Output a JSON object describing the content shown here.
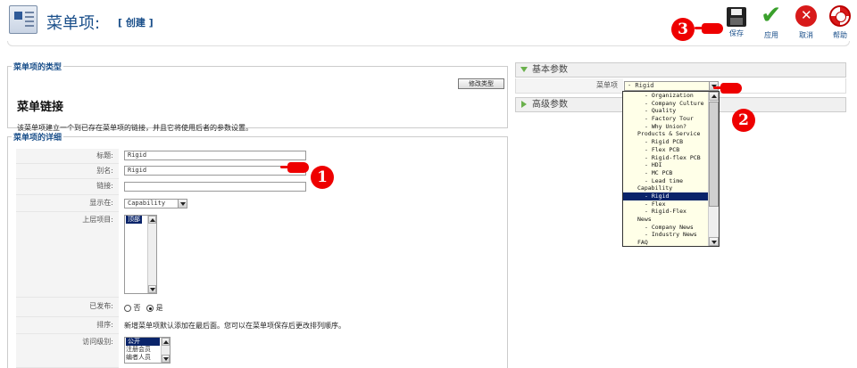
{
  "header": {
    "title": "菜单项:",
    "subtitle": "[ 创建 ]"
  },
  "toolbar": {
    "save_label": "保存",
    "apply_label": "应用",
    "cancel_label": "取消",
    "help_label": "帮助"
  },
  "markers": {
    "m1": "1",
    "m2": "2",
    "m3": "3"
  },
  "menu_type": {
    "legend": "菜单项的类型",
    "title": "菜单链接",
    "description": "该菜单项建立一个到已存在菜单项的链接，并且它将使用后者的参数设置。",
    "change_button": "修改类型"
  },
  "menu_details": {
    "legend": "菜单项的详细",
    "title_label": "标题:",
    "title_value": "Rigid",
    "alias_label": "别名:",
    "alias_value": "Rigid",
    "link_label": "链接:",
    "link_value": "",
    "display_label": "显示在:",
    "display_value": "Capability",
    "parent_label": "上层项目:",
    "parent_selected": "顶部",
    "published_label": "已发布:",
    "published_no": "否",
    "published_yes": "是",
    "order_label": "排序:",
    "order_text": "新增菜单项默认添加在最后面。您可以在菜单项保存后更改排列顺序。",
    "access_label": "访问级别:",
    "access_options": [
      "公开",
      "注册会员",
      "编者人员"
    ]
  },
  "basic_params": {
    "header": "基本参数",
    "menu_item_label": "菜单项",
    "menu_item_value": "- Rigid",
    "options": [
      "- Organization",
      "- Company Culture",
      "- Quality",
      "- Factory Tour",
      "- Why Union?",
      "Products & Service",
      "- Rigid PCB",
      "- Flex PCB",
      "- Rigid-flex PCB",
      "- HDI",
      "- MC PCB",
      "- Lead time",
      "Capability",
      "- Rigid",
      "- Flex",
      "- Rigid-Flex",
      "News",
      "- Company News",
      "- Industry News",
      "FAQ"
    ],
    "selected_index": 13
  },
  "advanced_params": {
    "header": "高级参数"
  },
  "colors": {
    "accent": "#1a4f8a",
    "marker": "#e00000",
    "selection": "#0a246a",
    "apply": "#3aa02c",
    "cancel": "#d81a1a"
  }
}
